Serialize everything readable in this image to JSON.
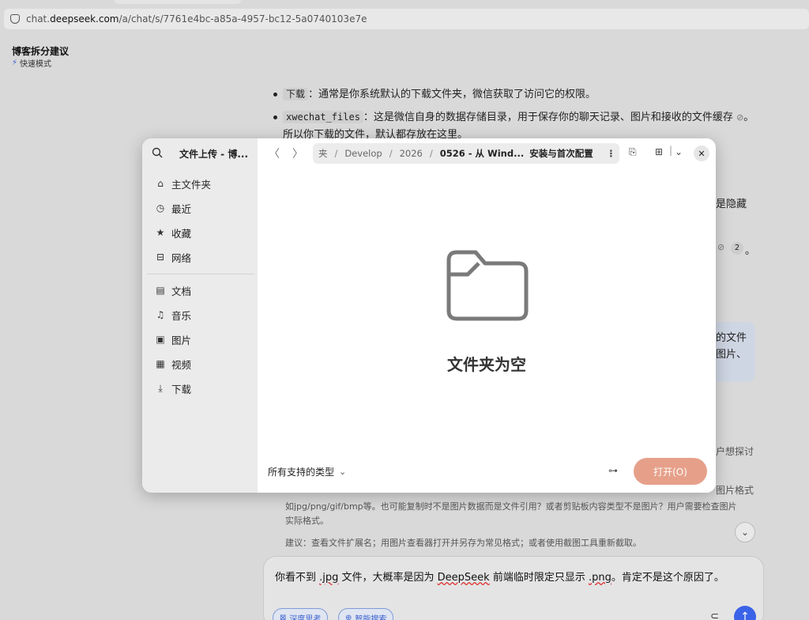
{
  "browser": {
    "url_prefix": "chat.",
    "url_host": "deepseek.com",
    "url_path": "/a/chat/s/7761e4bc-a85a-4957-bc12-5a0740103e7e"
  },
  "chat": {
    "title": "博客拆分建议",
    "mode": "快速模式"
  },
  "content": {
    "b1_code": "下载",
    "b1_text": "：通常是你系统默认的下载文件夹，微信获取了访问它的权限。",
    "b2_code": "xwechat_files",
    "b2_text": "：这是微信自身的数据存储目录，用于保存你的聊天记录、图片和接收的文件缓存",
    "b2_tail": "。",
    "b2_line2": "所以你下载的文件，默认都存放在这里。",
    "frag_hidden": "是隐藏",
    "frag_ref2": "2",
    "frag_period": "。",
    "frag_file": "的文件",
    "frag_image": "图片、",
    "frag_discuss": "户想探讨"
  },
  "reasoning": {
    "line1": "如jpg/png/gif/bmp等。也可能复制时不是图片数据而是文件引用？或者剪贴板内容类型不是图片？用户需要检查图片",
    "line2": "实际格式。",
    "line3": "建议：查看文件扩展名；用图片查看器打开并另存为常见格式；或者使用截图工具重新截取。",
    "frag_format": "图片格式"
  },
  "composer": {
    "text_before": "你看不到 ",
    "jpg": ".jpg",
    "text_mid": " 文件，大概率是因为 ",
    "deepseek": "DeepSeek",
    "text_mid2": " 前端临时限定只显示 ",
    "png": ".png",
    "text_after": "。肯定不是这个原因了。",
    "chip_deep": "深度思考",
    "chip_search": "智能搜索"
  },
  "dialog": {
    "title": "文件上传 - 博...",
    "sidebar": [
      {
        "label": "主文件夹",
        "icon": "home-icon",
        "glyph": "⌂"
      },
      {
        "label": "最近",
        "icon": "clock-icon",
        "glyph": "◷"
      },
      {
        "label": "收藏",
        "icon": "star-icon",
        "glyph": "★"
      },
      {
        "label": "网络",
        "icon": "network-icon",
        "glyph": "⊟"
      },
      {
        "label": "文档",
        "icon": "document-icon",
        "glyph": "▤"
      },
      {
        "label": "音乐",
        "icon": "music-icon",
        "glyph": "♫"
      },
      {
        "label": "图片",
        "icon": "picture-icon",
        "glyph": "▣"
      },
      {
        "label": "视频",
        "icon": "video-icon",
        "glyph": "▦"
      },
      {
        "label": "下载",
        "icon": "download-icon",
        "glyph": "⤓"
      }
    ],
    "path": [
      "夹",
      "Develop",
      "2026",
      "0526 - 从 Wind...",
      "安装与首次配置"
    ],
    "empty_message": "文件夹为空",
    "filter_label": "所有支持的类型",
    "open_button": "打开(O)"
  },
  "colors": {
    "accent": "#3b63e8",
    "open_button": "#e6a08a"
  }
}
